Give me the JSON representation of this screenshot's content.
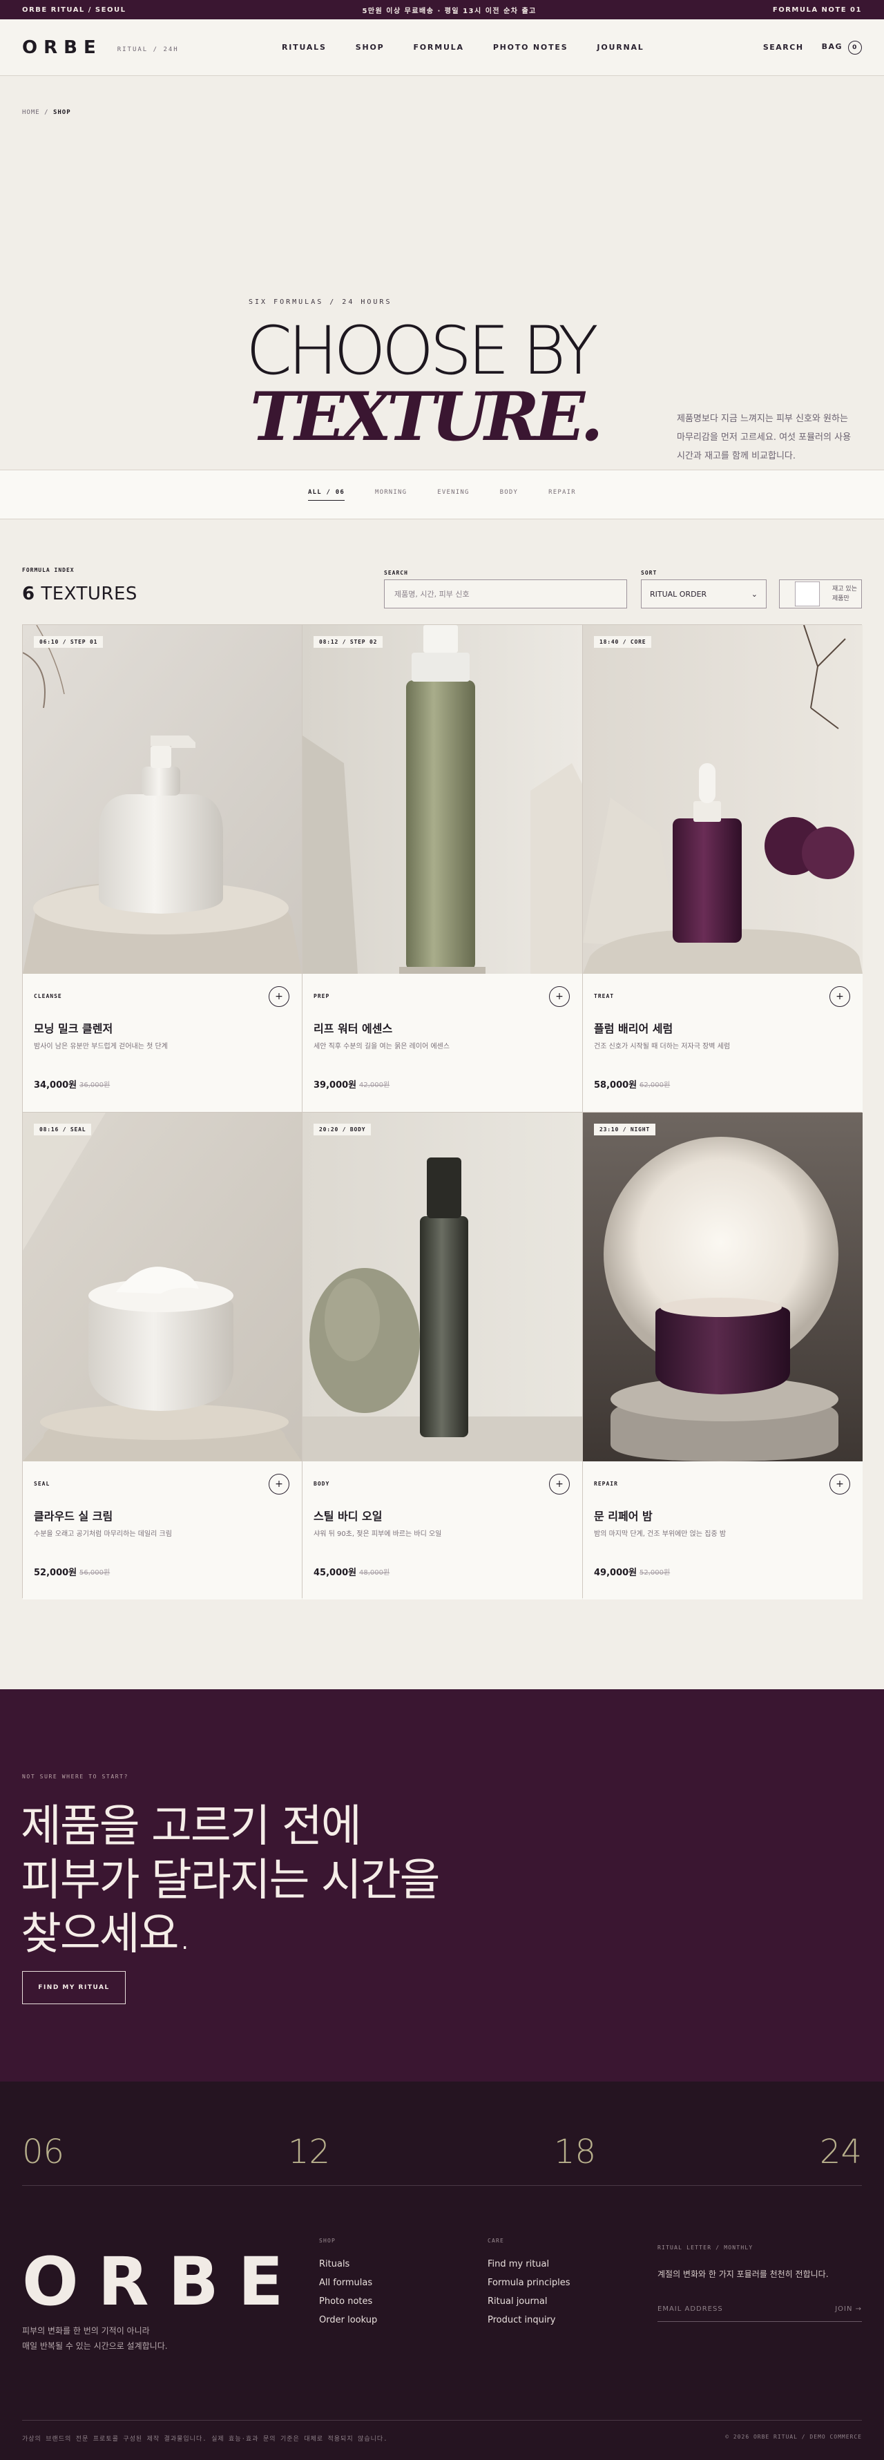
{
  "topbar": {
    "left": "ORBE RITUAL / SEOUL",
    "center": "5만원 이상 무료배송 · 평일 13시 이전 순차 출고",
    "right": "FORMULA NOTE 01"
  },
  "header": {
    "logo": "ORBE",
    "logo_sub": "RITUAL / 24H",
    "nav": [
      "RITUALS",
      "SHOP",
      "FORMULA",
      "PHOTO NOTES",
      "JOURNAL"
    ],
    "search": "SEARCH",
    "bag": "BAG",
    "bag_count": "0"
  },
  "breadcrumb": {
    "home": "HOME",
    "sep": "/",
    "current": "SHOP"
  },
  "hero": {
    "kicker": "SIX FORMULAS / 24 HOURS",
    "title_line1": "CHOOSE BY",
    "title_line2": "TEXTURE.",
    "description": "제품명보다 지금 느껴지는 피부 신호와 원하는 마무리감을 먼저 고르세요. 여섯 포뮬러의 사용 시간과 재고를 함께 비교합니다."
  },
  "tabs": [
    "ALL / 06",
    "MORNING",
    "EVENING",
    "BODY",
    "REPAIR"
  ],
  "index": {
    "label": "FORMULA INDEX",
    "count": "6",
    "count_label": "TEXTURES",
    "search_label": "SEARCH",
    "search_placeholder": "제품명, 시간, 피부 신호",
    "sort_label": "SORT",
    "sort_value": "RITUAL ORDER",
    "stock_text": "재고 있는 제품만"
  },
  "products": [
    {
      "tag": "06:10 / STEP 01",
      "category": "CLEANSE",
      "name": "모닝 밀크 클렌저",
      "desc": "밤사이 남은 유분만 부드럽게 걷어내는 첫 단계",
      "price": "34,000원",
      "old": "36,000원"
    },
    {
      "tag": "08:12 / STEP 02",
      "category": "PREP",
      "name": "리프 워터 에센스",
      "desc": "세안 직후 수분의 길을 여는 묽은 레이어 에센스",
      "price": "39,000원",
      "old": "42,000원"
    },
    {
      "tag": "18:40 / CORE",
      "category": "TREAT",
      "name": "플럼 배리어 세럼",
      "desc": "건조 신호가 시작될 때 더하는 저자극 장벽 세럼",
      "price": "58,000원",
      "old": "62,000원"
    },
    {
      "tag": "08:16 / SEAL",
      "category": "SEAL",
      "name": "클라우드 실 크림",
      "desc": "수분을 오래고 공기처럼 마무리하는 데일리 크림",
      "price": "52,000원",
      "old": "56,000원"
    },
    {
      "tag": "20:20 / BODY",
      "category": "BODY",
      "name": "스틸 바디 오일",
      "desc": "샤워 뒤 90초, 젖은 피부에 바르는 바디 오일",
      "price": "45,000원",
      "old": "48,000원"
    },
    {
      "tag": "23:10 / NIGHT",
      "category": "REPAIR",
      "name": "문 리페어 밤",
      "desc": "밤의 마지막 단계, 건조 부위에만 얹는 집중 밤",
      "price": "49,000원",
      "old": "52,000원"
    }
  ],
  "cta": {
    "kicker": "NOT SURE WHERE TO START?",
    "line1": "제품을 고르기 전에",
    "line2": "피부가 달라지는 시간을",
    "line3": "찾으세요.",
    "button": "FIND MY RITUAL"
  },
  "footer": {
    "hours": [
      "06",
      "12",
      "18",
      "24"
    ],
    "logo": "ORBE",
    "tagline_1": "피부의 변화를 한 번의 기적이 아니라",
    "tagline_2": "매일 반복될 수 있는 시간으로 설계합니다.",
    "shop_title": "SHOP",
    "shop_links": [
      "Rituals",
      "All formulas",
      "Photo notes",
      "Order lookup"
    ],
    "care_title": "CARE",
    "care_links": [
      "Find my ritual",
      "Formula principles",
      "Ritual journal",
      "Product inquiry"
    ],
    "news_label": "RITUAL LETTER / MONTHLY",
    "news_desc": "계절의 변화와 한 가지 포뮬러를 천천히 전합니다.",
    "email_placeholder": "EMAIL ADDRESS",
    "join": "JOIN →",
    "legal": "가상의 브랜드의 전문 프로토콜 구성된 제작 결과물입니다. 실제 효능·효과 문의 기준은 대체로 적용되지 않습니다.",
    "copyright": "© 2026 ORBE RITUAL / DEMO COMMERCE"
  }
}
